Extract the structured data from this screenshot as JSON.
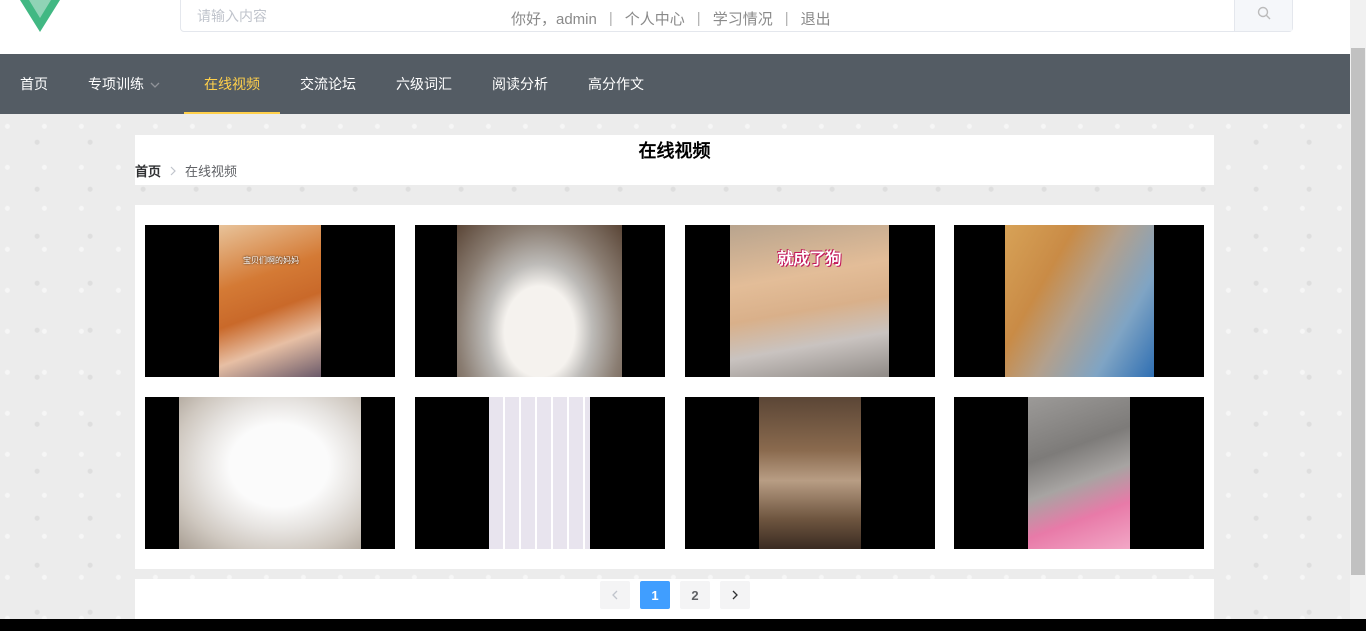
{
  "header": {
    "search_placeholder": "请输入内容",
    "user_links": [
      "你好，admin",
      "个人中心",
      "学习情况",
      "退出"
    ],
    "separator": "|"
  },
  "nav": {
    "items": [
      {
        "label": "首页",
        "active": false
      },
      {
        "label": "专项训练",
        "active": false,
        "has_dropdown": true
      },
      {
        "label": "在线视频",
        "active": true
      },
      {
        "label": "交流论坛",
        "active": false
      },
      {
        "label": "六级词汇",
        "active": false
      },
      {
        "label": "阅读分析",
        "active": false
      },
      {
        "label": "高分作文",
        "active": false
      }
    ],
    "active_color": "#ffd04b",
    "bg_color": "#545c64"
  },
  "page": {
    "title": "在线视频",
    "breadcrumb": {
      "home": "首页",
      "current": "在线视频"
    }
  },
  "videos": [
    {
      "name": "video-1",
      "caption": "宝贝们啊的妈妈"
    },
    {
      "name": "video-2",
      "caption": ""
    },
    {
      "name": "video-3",
      "caption": "就成了狗"
    },
    {
      "name": "video-4",
      "caption": ""
    },
    {
      "name": "video-5",
      "caption": ""
    },
    {
      "name": "video-6",
      "caption": ""
    },
    {
      "name": "video-7",
      "caption": ""
    },
    {
      "name": "video-8",
      "caption": ""
    }
  ],
  "pagination": {
    "pages": [
      "1",
      "2"
    ],
    "current": "1",
    "accent": "#409eff"
  }
}
